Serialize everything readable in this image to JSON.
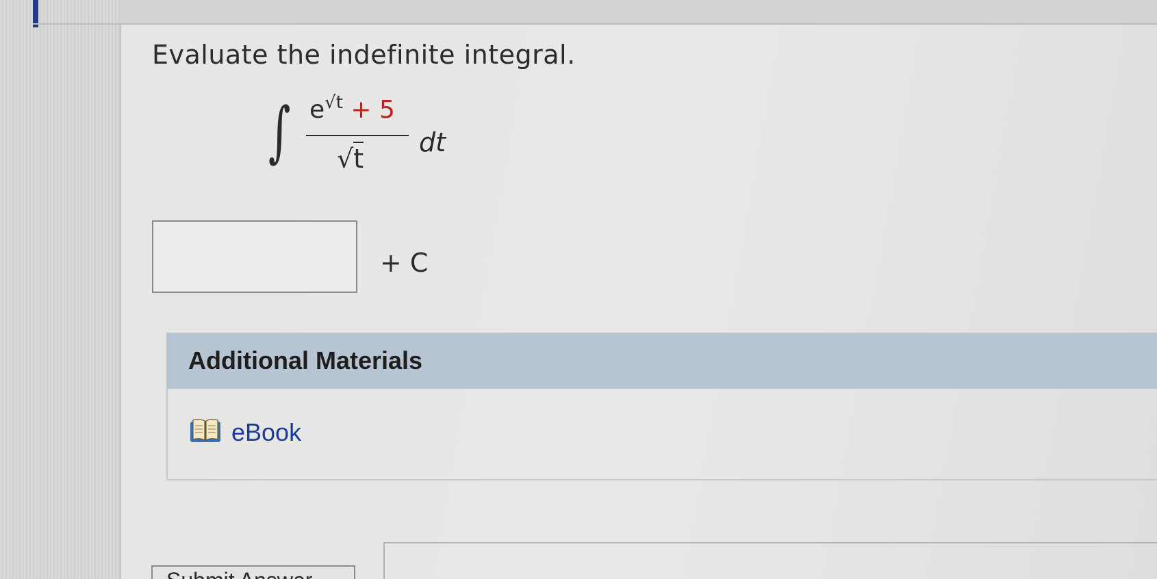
{
  "question": {
    "prompt": "Evaluate the indefinite integral.",
    "integral": {
      "symbol": "∫",
      "numerator_base": "e",
      "numerator_exponent": "√t",
      "numerator_plus": "+ 5",
      "denominator_radical": "√",
      "denominator_var": "t",
      "differential": "dt"
    },
    "answer": {
      "value": "",
      "constant": "+ C"
    }
  },
  "additional_materials": {
    "title": "Additional Materials",
    "links": [
      {
        "label": "eBook",
        "icon": "book-icon"
      }
    ]
  },
  "actions": {
    "submit_label": "Submit Answer"
  },
  "colors": {
    "accent_red": "#c0201f",
    "link_blue": "#1c3a9e",
    "header_blue": "#b6c4d4"
  }
}
